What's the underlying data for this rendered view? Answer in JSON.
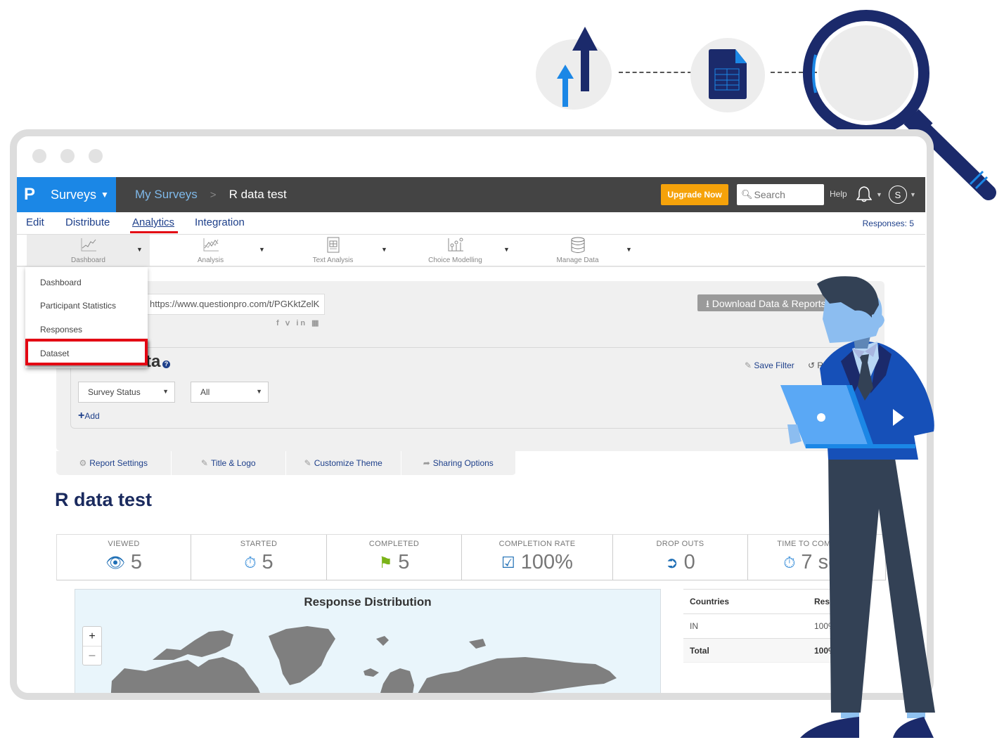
{
  "illustration": {
    "step_icons": [
      "upload-arrows-icon",
      "spreadsheet-document-icon",
      "magnifying-glass-icon"
    ]
  },
  "header": {
    "logo": "P",
    "product": "Surveys",
    "breadcrumb": [
      "My Surveys",
      "R data test"
    ],
    "breadcrumb_separator": ">",
    "upgrade_label": "Upgrade Now",
    "search_placeholder": "Search",
    "help_label": "Help",
    "avatar_initial": "S"
  },
  "tabs": {
    "items": [
      "Edit",
      "Distribute",
      "Analytics",
      "Integration"
    ],
    "active": "Analytics",
    "responses": "Responses: 5"
  },
  "toolbar": {
    "items": [
      {
        "label": "Dashboard",
        "icon": "line-chart-icon"
      },
      {
        "label": "Analysis",
        "icon": "multi-line-chart-icon"
      },
      {
        "label": "Text Analysis",
        "icon": "text-document-icon"
      },
      {
        "label": "Choice Modelling",
        "icon": "scatter-chart-icon"
      },
      {
        "label": "Manage Data",
        "icon": "database-icon"
      }
    ]
  },
  "dashboard_menu": {
    "items": [
      "Dashboard",
      "Participant Statistics",
      "Responses",
      "Dataset"
    ],
    "highlighted": "Dataset"
  },
  "share": {
    "url": "https://www.questionpro.com/t/PGKktZelK",
    "social": [
      "facebook",
      "twitter",
      "linkedin",
      "qr-code"
    ],
    "download_label": "Download Data & Reports"
  },
  "filter": {
    "title": "Filter Data",
    "save_filter": "Save Filter",
    "reset": "Reset",
    "field_select": "Survey Status",
    "value_select": "All",
    "add_label": "Add"
  },
  "subtabs": [
    "Report Settings",
    "Title & Logo",
    "Customize Theme",
    "Sharing Options"
  ],
  "report": {
    "title": "R data test"
  },
  "stats": [
    {
      "label": "VIEWED",
      "value": "5",
      "icon": "eye-icon",
      "color": "#1f6fb5"
    },
    {
      "label": "STARTED",
      "value": "5",
      "icon": "stopwatch-icon",
      "color": "#3b8fd9"
    },
    {
      "label": "COMPLETED",
      "value": "5",
      "icon": "flag-icon",
      "color": "#7ab317"
    },
    {
      "label": "COMPLETION RATE",
      "value": "100%",
      "icon": "checkbox-icon",
      "color": "#1f6fb5"
    },
    {
      "label": "DROP OUTS",
      "value": "0",
      "icon": "exit-icon",
      "color": "#1f6fb5"
    },
    {
      "label": "TIME TO COMPLETE",
      "value": "7 sec",
      "icon": "stopwatch-icon",
      "color": "#3b8fd9"
    }
  ],
  "map": {
    "title": "Response Distribution",
    "zoom_in": "+",
    "zoom_out": "–"
  },
  "countries_table": {
    "headers": [
      "Countries",
      "Responses"
    ],
    "rows": [
      [
        "IN",
        "100%"
      ]
    ],
    "total": [
      "Total",
      "100%"
    ]
  }
}
